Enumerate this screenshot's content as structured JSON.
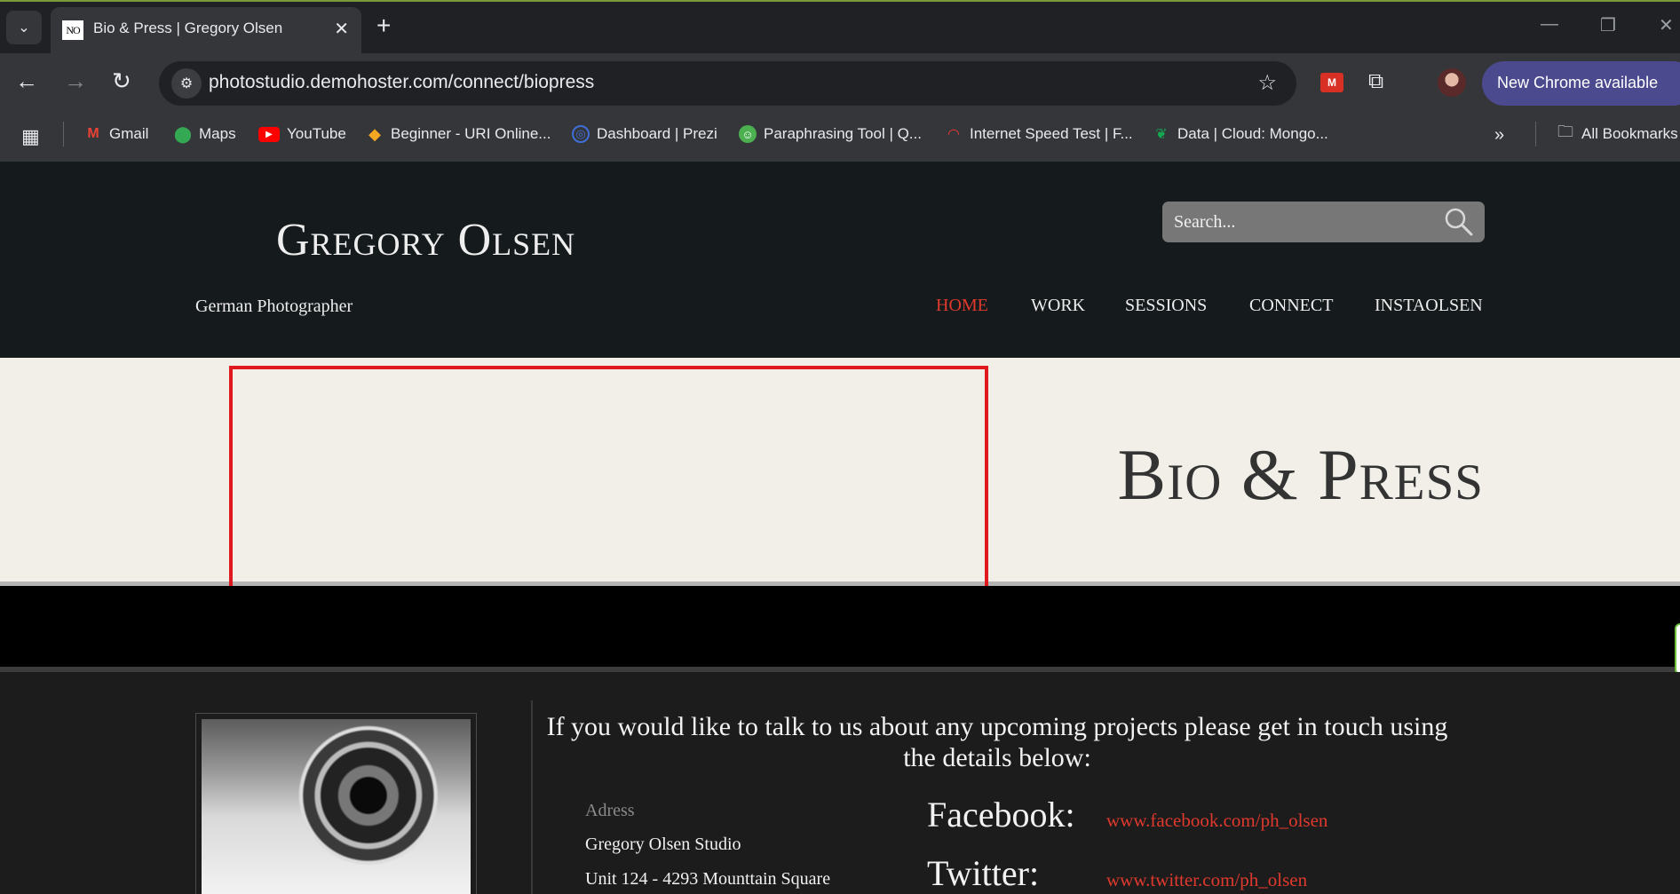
{
  "browser": {
    "tab": {
      "favicon_text": "NO",
      "title": "Bio & Press | Gregory Olsen"
    },
    "url": "photostudio.demohoster.com/connect/biopress",
    "update_label": "New Chrome available",
    "bookmarks": [
      {
        "label": "Gmail",
        "icon": "gmail-icon",
        "color": "#ea4335"
      },
      {
        "label": "Maps",
        "icon": "maps-icon",
        "color": "#34a853"
      },
      {
        "label": "YouTube",
        "icon": "youtube-icon",
        "color": "#ff0000"
      },
      {
        "label": "Beginner - URI Online...",
        "icon": "uri-icon",
        "color": "#f5a623"
      },
      {
        "label": "Dashboard | Prezi",
        "icon": "prezi-icon",
        "color": "#3e6fd8"
      },
      {
        "label": "Paraphrasing Tool | Q...",
        "icon": "quillbot-icon",
        "color": "#4caf50"
      },
      {
        "label": "Internet Speed Test | F...",
        "icon": "speedtest-icon",
        "color": "#e53935"
      },
      {
        "label": "Data | Cloud: Mongo...",
        "icon": "mongodb-icon",
        "color": "#13aa52"
      }
    ],
    "all_bookmarks_label": "All Bookmarks"
  },
  "site": {
    "brand": "Gregory Olsen",
    "tagline": "German Photographer",
    "search_placeholder": "Search...",
    "nav": [
      {
        "label": "HOME",
        "active": true
      },
      {
        "label": "WORK",
        "active": false
      },
      {
        "label": "SESSIONS",
        "active": false
      },
      {
        "label": "CONNECT",
        "active": false
      },
      {
        "label": "INSTAOLSEN",
        "active": false
      }
    ],
    "hero_title": "Bio & Press",
    "accent_color": "#e0392d",
    "highlight_color": "#e0191f"
  },
  "contact": {
    "intro": "If you would like to talk to us about any upcoming projects please get in touch using the details below:",
    "address_label": "Adress",
    "address_lines": [
      "Gregory Olsen Studio",
      "Unit 124 - 4293 Mounttain Square"
    ],
    "social": [
      {
        "label": "Facebook:",
        "link": "www.facebook.com/ph_olsen"
      },
      {
        "label": "Twitter:",
        "link": "www.twitter.com/ph_olsen"
      }
    ]
  }
}
